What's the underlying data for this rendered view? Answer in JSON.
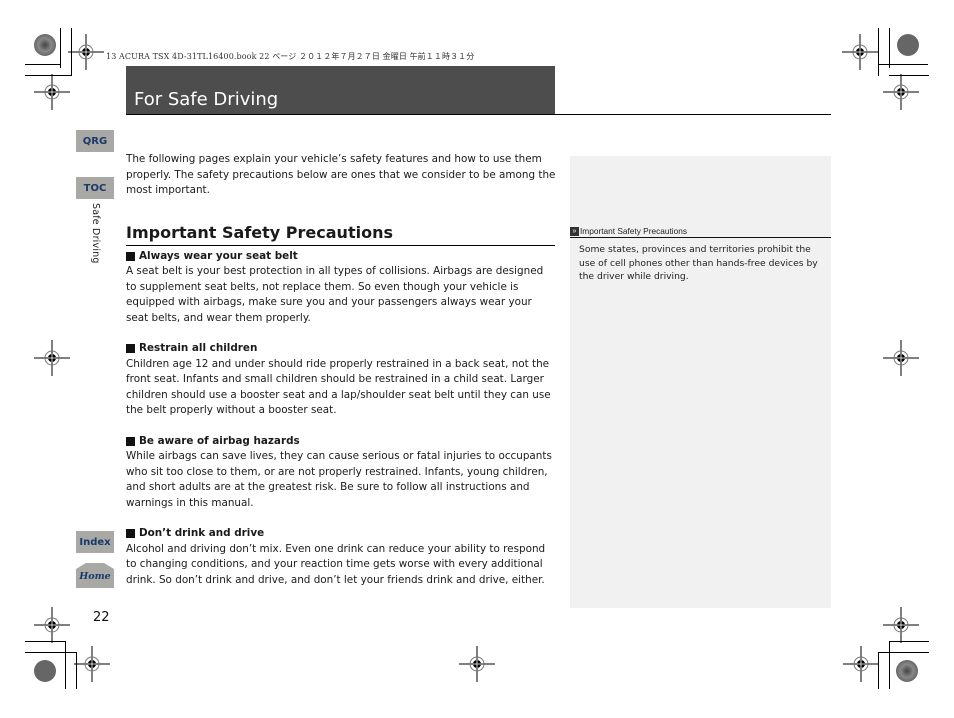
{
  "print_header": "13 ACURA TSX 4D-31TL16400.book  22 ページ  ２０１２年７月２７日  金曜日  午前１１時３１分",
  "page_title": "For Safe Driving",
  "nav": {
    "qrg": "QRG",
    "toc": "TOC",
    "index": "Index",
    "home": "Home"
  },
  "side_label": "Safe Driving",
  "page_number": "22",
  "main": {
    "intro": "The following pages explain your vehicle’s safety features and how to use them properly. The safety precautions below are ones that we consider to be among the most important.",
    "section_title": "Important Safety Precautions",
    "precautions": [
      {
        "heading": "Always wear your seat belt",
        "body": "A seat belt is your best protection in all types of collisions. Airbags are designed to supplement seat belts, not replace them. So even though your vehicle is equipped with airbags, make sure you and your passengers always wear your seat belts, and wear them properly."
      },
      {
        "heading": "Restrain all children",
        "body": "Children age 12 and under should ride properly restrained in a back seat, not the front seat. Infants and small children should be restrained in a child seat. Larger children should use a booster seat and a lap/shoulder seat belt until they can use the belt properly without a booster seat."
      },
      {
        "heading": "Be aware of airbag hazards",
        "body": "While airbags can save lives, they can cause serious or fatal injuries to occupants who sit too close to them, or are not properly restrained. Infants, young children, and short adults are at the greatest risk. Be sure to follow all instructions and warnings in this manual."
      },
      {
        "heading": "Don’t drink and drive",
        "body": "Alcohol and driving don’t mix. Even one drink can reduce your ability to respond to changing conditions, and your reaction time gets worse with every additional drink. So don’t drink and drive, and don’t let your friends drink and drive, either."
      }
    ]
  },
  "sidebar": {
    "ref_title": "Important Safety Precautions",
    "note": "Some states, provinces and territories prohibit the use of cell phones other than hands-free devices by the driver while driving."
  },
  "colors": {
    "title_bar": "#4d4d4d",
    "nav_tab": "#a8a8a4",
    "nav_text": "#1a3a6a",
    "sidebar_panel": "#f1f1f1"
  }
}
